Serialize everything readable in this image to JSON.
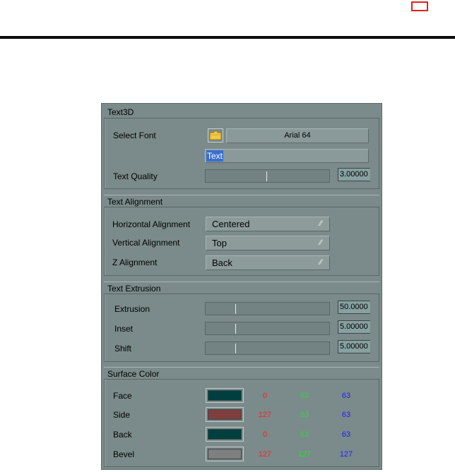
{
  "panel": {
    "title": "Text3D",
    "select_font_label": "Select Font",
    "font_button": "Arial 64",
    "text_value": "Text",
    "text_quality_label": "Text Quality",
    "text_quality_value": "3.00000",
    "text_quality_fraction": 0.49
  },
  "alignment": {
    "header": "Text Alignment",
    "horizontal_label": "Horizontal Alignment",
    "horizontal_value": "Centered",
    "vertical_label": "Vertical Alignment",
    "vertical_value": "Top",
    "z_label": "Z Alignment",
    "z_value": "Back"
  },
  "extrusion": {
    "header": "Text Extrusion",
    "extrusion_label": "Extrusion",
    "extrusion_value": "50.0000",
    "extrusion_fraction": 0.24,
    "inset_label": "Inset",
    "inset_value": "5.00000",
    "inset_fraction": 0.24,
    "shift_label": "Shift",
    "shift_value": "5.00000",
    "shift_fraction": 0.24
  },
  "surface": {
    "header": "Surface Color",
    "rows": [
      {
        "label": "Face",
        "r": "0",
        "g": "63",
        "b": "63",
        "color": "#003f3f"
      },
      {
        "label": "Side",
        "r": "127",
        "g": "63",
        "b": "63",
        "color": "#7f3f3f"
      },
      {
        "label": "Back",
        "r": "0",
        "g": "63",
        "b": "63",
        "color": "#003f3f"
      },
      {
        "label": "Bevel",
        "r": "127",
        "g": "127",
        "b": "127",
        "color": "#7f7f7f"
      }
    ]
  },
  "colors": {
    "red": "#ff2020",
    "green": "#20e030",
    "blue": "#2020ff"
  }
}
